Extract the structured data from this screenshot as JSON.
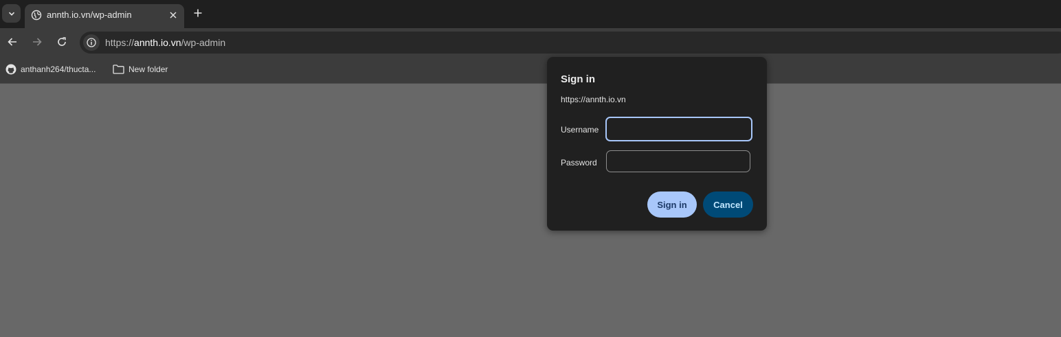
{
  "tabs": [
    {
      "title": "annth.io.vn/wp-admin",
      "icon": "globe-icon"
    }
  ],
  "address_bar": {
    "scheme": "https://",
    "host": "annth.io.vn",
    "path": "/wp-admin"
  },
  "bookmarks": [
    {
      "label": "anthanh264/thucta...",
      "icon": "github-icon"
    },
    {
      "label": "New folder",
      "icon": "folder-icon"
    }
  ],
  "dialog": {
    "title": "Sign in",
    "origin": "https://annth.io.vn",
    "username_label": "Username",
    "username_value": "",
    "password_label": "Password",
    "password_value": "",
    "signin_label": "Sign in",
    "cancel_label": "Cancel"
  },
  "colors": {
    "page_background": "#686868",
    "primary_button": "#a8c7fa",
    "secondary_button": "#004a77",
    "focus_ring": "#a8c7fa"
  }
}
